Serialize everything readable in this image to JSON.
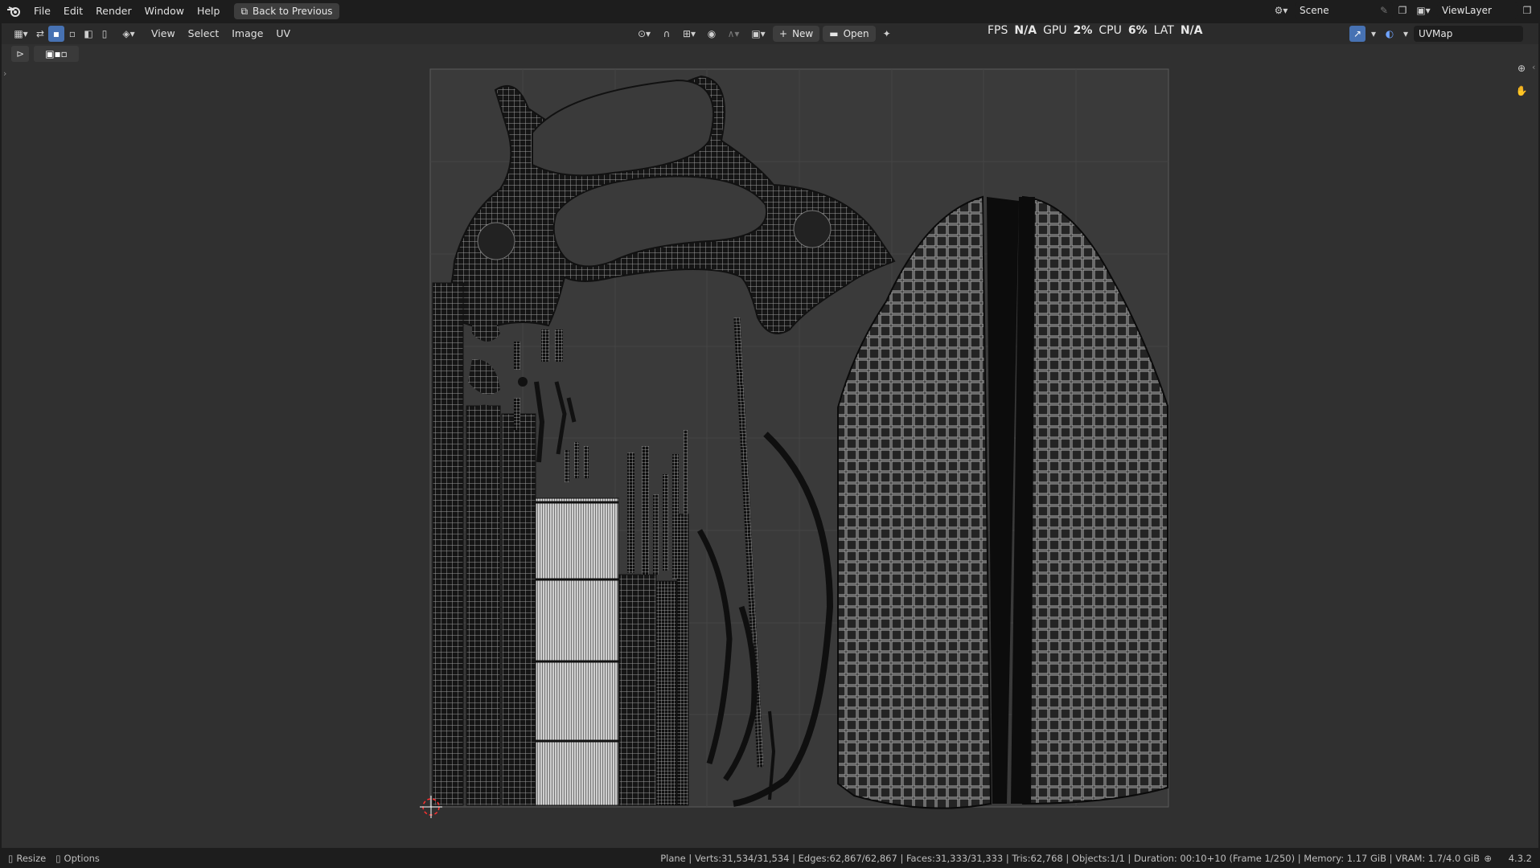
{
  "menu": [
    "File",
    "Edit",
    "Render",
    "Window",
    "Help"
  ],
  "back_button": "Back to Previous",
  "scene_name": "Scene",
  "view_layer": "ViewLayer",
  "uv_menus": [
    "View",
    "Select",
    "Image",
    "UV"
  ],
  "image_new": "New",
  "image_open": "Open",
  "uvmap_name": "UVMap",
  "perf": {
    "fps_label": "FPS",
    "fps": "N/A",
    "gpu_label": "GPU",
    "gpu": "2%",
    "cpu_label": "CPU",
    "cpu": "6%",
    "lat_label": "LAT",
    "lat": "N/A"
  },
  "status": {
    "resize": "Resize",
    "options": "Options",
    "info": "Plane | Verts:31,534/31,534 | Edges:62,867/62,867 | Faces:31,333/31,333 | Tris:62,768 | Objects:1/1 | Duration: 00:10+10 (Frame 1/250) | Memory: 1.17 GiB | VRAM: 1.7/4.0 GiB",
    "version": "4.3.2"
  }
}
